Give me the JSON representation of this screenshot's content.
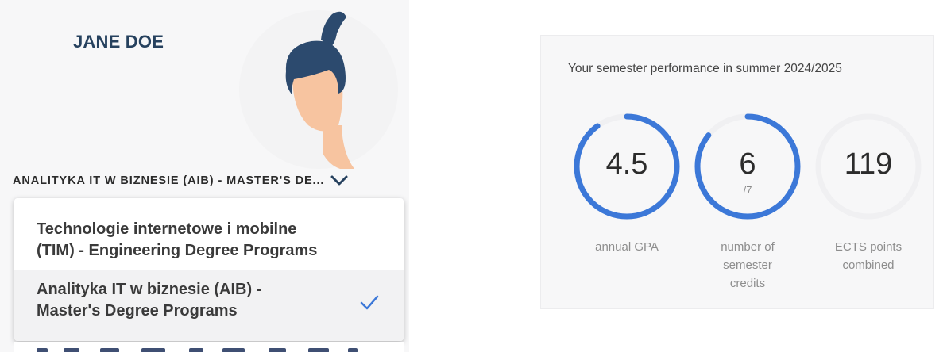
{
  "profile": {
    "name": "JANE DOE",
    "avatar_icon": "student-avatar-icon",
    "selected_program_label": "ANALITYKA IT W BIZNESIE (AIB) - MASTER'S DE...",
    "chevron_icon": "chevron-down-icon"
  },
  "dropdown": {
    "options": [
      {
        "line1": "Technologie internetowe i mobilne",
        "line2": "(TIM) - Engineering Degree Programs",
        "selected": false
      },
      {
        "line1": "Analityka IT w biznesie (AIB) -",
        "line2": "Master's Degree Programs",
        "selected": true
      }
    ],
    "check_icon": "check-icon"
  },
  "performance": {
    "title": "Your semester performance in summer 2024/2025",
    "stats": [
      {
        "value": "4.5",
        "sub": "",
        "label_lines": [
          "annual GPA"
        ],
        "fill": 0.9
      },
      {
        "value": "6",
        "sub": "/7",
        "label_lines": [
          "number of",
          "semester",
          "credits"
        ],
        "fill": 0.857
      },
      {
        "value": "119",
        "sub": "",
        "label_lines": [
          "ECTS points",
          "combined"
        ],
        "fill": 0
      }
    ]
  },
  "colors": {
    "accent": "#3c78d8",
    "ring_track": "#f0f0f2",
    "name": "#26415e",
    "hair": "#2c4a6e",
    "skin": "#f7c4a0"
  }
}
